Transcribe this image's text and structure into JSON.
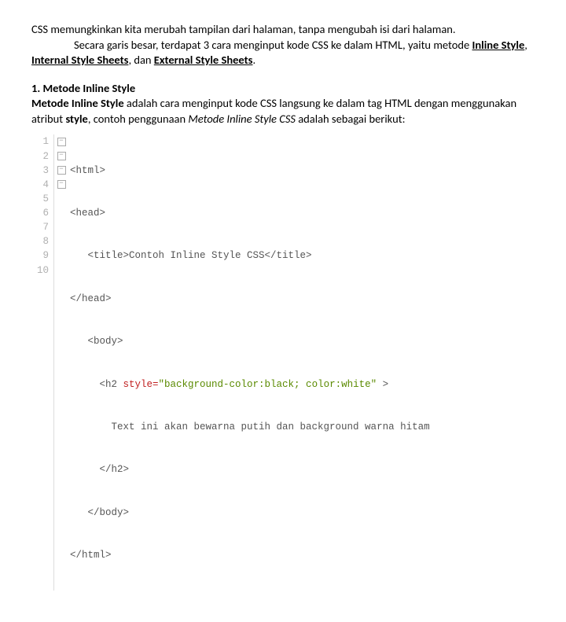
{
  "intro": {
    "p1": "CSS memungkinkan kita merubah tampilan dari halaman, tanpa mengubah isi dari halaman.",
    "p2a": "Secara garis besar, terdapat 3 cara menginput kode CSS ke dalam HTML, yaitu metode ",
    "b1": "Inline Style",
    "sep1": ", ",
    "b2": "Internal Style Sheets",
    "sep2": ", dan ",
    "b3": "External Style Sheets",
    "end": "."
  },
  "section1": {
    "heading": "1. Metode Inline Style",
    "lead_b": "Metode Inline Style",
    "lead_rest": " adalah cara menginput kode CSS langsung ke dalam tag HTML dengan menggunakan atribut ",
    "lead_b2": "style",
    "lead_rest2": ", contoh penggunaan ",
    "lead_em": "Metode Inline Style CSS",
    "lead_rest3": " adalah sebagai berikut:"
  },
  "code": {
    "lines": {
      "1": "<html>",
      "2": "<head>",
      "3": "   <title>Contoh Inline Style CSS</title>",
      "4": "</head>",
      "5": "   <body>",
      "7": "       Text ini akan bewarna putih dan background warna hitam",
      "8": "     </h2>",
      "9": "   </body>",
      "10": "</html>"
    },
    "line6": {
      "pre": "     <h2 ",
      "attr": "style=",
      "val": "\"background-color:black; color:white\"",
      "post": " >"
    },
    "lineNumbers": [
      "1",
      "2",
      "3",
      "4",
      "5",
      "6",
      "7",
      "8",
      "9",
      "10"
    ],
    "fold": {
      "box": "−",
      "pipe": " "
    }
  }
}
